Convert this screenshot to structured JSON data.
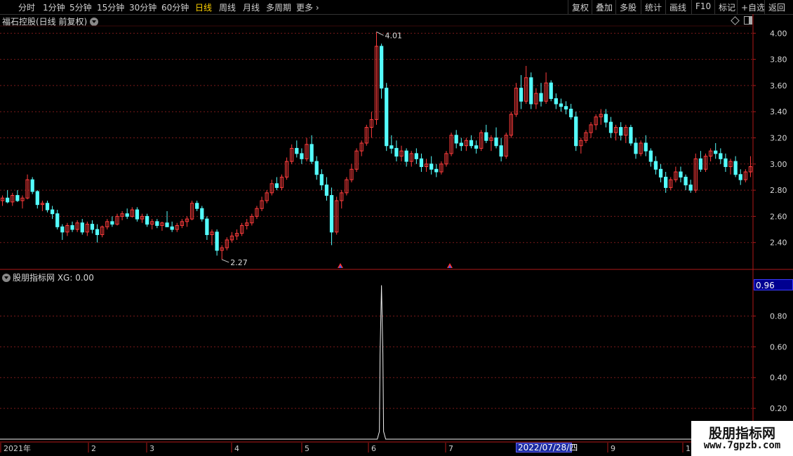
{
  "toolbar": {
    "left_items": [
      "分时",
      "1分钟",
      "5分钟",
      "15分钟",
      "30分钟",
      "60分钟",
      "日线",
      "周线",
      "月线",
      "多周期",
      "更多"
    ],
    "active": "日线",
    "right_items": [
      "复权",
      "叠加",
      "多股",
      "统计",
      "画线",
      "F10",
      "标记",
      "+自选",
      "返回"
    ]
  },
  "main_chart": {
    "header": "福石控股(日线 前复权)",
    "price_labels": [
      "4.00",
      "3.80",
      "3.60",
      "3.40",
      "3.20",
      "3.00",
      "2.80",
      "2.60",
      "2.40"
    ],
    "high_marker": "4.01",
    "low_marker": "2.27",
    "colors": {
      "up": "#ff3c3c",
      "down": "#54fcfc",
      "grid": "#7a1a1a",
      "axis": "#b01818"
    }
  },
  "indicator": {
    "header": "股朋指标网 XG: 0.00",
    "value_box": "0.96",
    "axis_labels": [
      "0.80",
      "0.60",
      "0.40",
      "0.20"
    ]
  },
  "time_axis": {
    "labels": [
      "2021年",
      "2",
      "3",
      "4",
      "5",
      "6",
      "7",
      "9",
      "1"
    ],
    "highlight": "2022/07/28/四"
  },
  "watermark": {
    "line1": "股朋指标网",
    "line2": "www.7gpzb.com"
  },
  "chart_data": {
    "type": "candlestick",
    "title": "福石控股(日线 前复权)",
    "y_range": [
      2.2,
      4.05
    ],
    "ohlc": [
      [
        2.72,
        2.76,
        2.68,
        2.74
      ],
      [
        2.74,
        2.8,
        2.7,
        2.71
      ],
      [
        2.71,
        2.78,
        2.68,
        2.76
      ],
      [
        2.76,
        2.8,
        2.71,
        2.72
      ],
      [
        2.72,
        2.76,
        2.66,
        2.74
      ],
      [
        2.74,
        2.92,
        2.73,
        2.88
      ],
      [
        2.88,
        2.9,
        2.77,
        2.79
      ],
      [
        2.79,
        2.8,
        2.66,
        2.69
      ],
      [
        2.69,
        2.72,
        2.64,
        2.7
      ],
      [
        2.7,
        2.72,
        2.63,
        2.65
      ],
      [
        2.65,
        2.68,
        2.58,
        2.62
      ],
      [
        2.62,
        2.65,
        2.5,
        2.52
      ],
      [
        2.52,
        2.54,
        2.42,
        2.48
      ],
      [
        2.48,
        2.55,
        2.45,
        2.53
      ],
      [
        2.53,
        2.56,
        2.48,
        2.5
      ],
      [
        2.5,
        2.57,
        2.48,
        2.55
      ],
      [
        2.55,
        2.58,
        2.46,
        2.48
      ],
      [
        2.48,
        2.56,
        2.45,
        2.54
      ],
      [
        2.54,
        2.57,
        2.47,
        2.5
      ],
      [
        2.5,
        2.54,
        2.4,
        2.46
      ],
      [
        2.46,
        2.53,
        2.44,
        2.52
      ],
      [
        2.52,
        2.58,
        2.5,
        2.56
      ],
      [
        2.56,
        2.6,
        2.52,
        2.54
      ],
      [
        2.54,
        2.62,
        2.53,
        2.6
      ],
      [
        2.6,
        2.64,
        2.57,
        2.62
      ],
      [
        2.62,
        2.66,
        2.58,
        2.6
      ],
      [
        2.6,
        2.67,
        2.59,
        2.65
      ],
      [
        2.65,
        2.67,
        2.56,
        2.58
      ],
      [
        2.58,
        2.62,
        2.55,
        2.6
      ],
      [
        2.6,
        2.62,
        2.52,
        2.54
      ],
      [
        2.54,
        2.58,
        2.5,
        2.56
      ],
      [
        2.56,
        2.58,
        2.51,
        2.53
      ],
      [
        2.53,
        2.56,
        2.49,
        2.55
      ],
      [
        2.55,
        2.64,
        2.53,
        2.52
      ],
      [
        2.52,
        2.56,
        2.48,
        2.5
      ],
      [
        2.5,
        2.55,
        2.48,
        2.53
      ],
      [
        2.53,
        2.58,
        2.51,
        2.56
      ],
      [
        2.56,
        2.6,
        2.52,
        2.58
      ],
      [
        2.58,
        2.72,
        2.57,
        2.7
      ],
      [
        2.7,
        2.72,
        2.64,
        2.66
      ],
      [
        2.66,
        2.68,
        2.56,
        2.58
      ],
      [
        2.58,
        2.6,
        2.42,
        2.46
      ],
      [
        2.46,
        2.5,
        2.38,
        2.48
      ],
      [
        2.48,
        2.5,
        2.3,
        2.34
      ],
      [
        2.34,
        2.38,
        2.27,
        2.36
      ],
      [
        2.36,
        2.44,
        2.34,
        2.42
      ],
      [
        2.42,
        2.48,
        2.4,
        2.45
      ],
      [
        2.45,
        2.5,
        2.42,
        2.47
      ],
      [
        2.47,
        2.55,
        2.45,
        2.53
      ],
      [
        2.53,
        2.58,
        2.5,
        2.55
      ],
      [
        2.55,
        2.62,
        2.53,
        2.6
      ],
      [
        2.6,
        2.68,
        2.58,
        2.66
      ],
      [
        2.66,
        2.75,
        2.64,
        2.72
      ],
      [
        2.72,
        2.8,
        2.7,
        2.78
      ],
      [
        2.78,
        2.88,
        2.76,
        2.85
      ],
      [
        2.85,
        2.9,
        2.8,
        2.82
      ],
      [
        2.82,
        2.92,
        2.8,
        2.9
      ],
      [
        2.9,
        3.05,
        2.88,
        3.02
      ],
      [
        3.02,
        3.15,
        3.0,
        3.12
      ],
      [
        3.12,
        3.18,
        3.05,
        3.08
      ],
      [
        3.08,
        3.12,
        3.0,
        3.04
      ],
      [
        3.04,
        3.2,
        3.02,
        3.15
      ],
      [
        3.15,
        3.22,
        3.0,
        3.02
      ],
      [
        3.02,
        3.06,
        2.88,
        2.92
      ],
      [
        2.92,
        2.96,
        2.8,
        2.84
      ],
      [
        2.84,
        2.9,
        2.72,
        2.76
      ],
      [
        2.76,
        2.82,
        2.38,
        2.48
      ],
      [
        2.48,
        2.75,
        2.46,
        2.72
      ],
      [
        2.72,
        2.8,
        2.66,
        2.78
      ],
      [
        2.78,
        2.9,
        2.76,
        2.88
      ],
      [
        2.88,
        3.0,
        2.86,
        2.96
      ],
      [
        2.96,
        3.12,
        2.94,
        3.1
      ],
      [
        3.1,
        3.18,
        3.06,
        3.16
      ],
      [
        3.16,
        3.3,
        3.14,
        3.28
      ],
      [
        3.28,
        3.4,
        3.2,
        3.34
      ],
      [
        3.34,
        4.01,
        3.3,
        3.9
      ],
      [
        3.9,
        3.92,
        3.5,
        3.58
      ],
      [
        3.58,
        3.62,
        3.1,
        3.14
      ],
      [
        3.14,
        3.22,
        3.08,
        3.12
      ],
      [
        3.12,
        3.18,
        3.02,
        3.06
      ],
      [
        3.06,
        3.14,
        3.02,
        3.1
      ],
      [
        3.1,
        3.12,
        2.98,
        3.02
      ],
      [
        3.02,
        3.1,
        2.98,
        3.08
      ],
      [
        3.08,
        3.12,
        3.0,
        3.04
      ],
      [
        3.04,
        3.08,
        2.94,
        2.98
      ],
      [
        2.98,
        3.04,
        2.94,
        3.0
      ],
      [
        3.0,
        3.06,
        2.92,
        2.96
      ],
      [
        2.96,
        3.0,
        2.9,
        2.94
      ],
      [
        2.94,
        3.02,
        2.92,
        3.0
      ],
      [
        3.0,
        3.1,
        2.98,
        3.08
      ],
      [
        3.08,
        3.24,
        3.06,
        3.22
      ],
      [
        3.22,
        3.26,
        3.12,
        3.16
      ],
      [
        3.16,
        3.2,
        3.1,
        3.14
      ],
      [
        3.14,
        3.2,
        3.1,
        3.18
      ],
      [
        3.18,
        3.22,
        3.12,
        3.14
      ],
      [
        3.14,
        3.18,
        3.08,
        3.12
      ],
      [
        3.12,
        3.26,
        3.1,
        3.24
      ],
      [
        3.24,
        3.3,
        3.16,
        3.18
      ],
      [
        3.18,
        3.22,
        3.1,
        3.2
      ],
      [
        3.2,
        3.28,
        3.12,
        3.14
      ],
      [
        3.14,
        3.2,
        3.02,
        3.06
      ],
      [
        3.06,
        3.24,
        3.04,
        3.22
      ],
      [
        3.22,
        3.4,
        3.2,
        3.38
      ],
      [
        3.38,
        3.62,
        3.36,
        3.58
      ],
      [
        3.58,
        3.68,
        3.42,
        3.48
      ],
      [
        3.48,
        3.75,
        3.46,
        3.66
      ],
      [
        3.66,
        3.7,
        3.42,
        3.46
      ],
      [
        3.46,
        3.58,
        3.42,
        3.54
      ],
      [
        3.54,
        3.62,
        3.44,
        3.48
      ],
      [
        3.48,
        3.7,
        3.46,
        3.62
      ],
      [
        3.62,
        3.64,
        3.48,
        3.5
      ],
      [
        3.5,
        3.54,
        3.42,
        3.46
      ],
      [
        3.46,
        3.5,
        3.4,
        3.44
      ],
      [
        3.44,
        3.48,
        3.38,
        3.42
      ],
      [
        3.42,
        3.46,
        3.34,
        3.36
      ],
      [
        3.36,
        3.4,
        3.1,
        3.14
      ],
      [
        3.14,
        3.2,
        3.08,
        3.18
      ],
      [
        3.18,
        3.26,
        3.16,
        3.24
      ],
      [
        3.24,
        3.32,
        3.2,
        3.3
      ],
      [
        3.3,
        3.38,
        3.26,
        3.36
      ],
      [
        3.36,
        3.42,
        3.3,
        3.38
      ],
      [
        3.38,
        3.42,
        3.28,
        3.32
      ],
      [
        3.32,
        3.36,
        3.2,
        3.24
      ],
      [
        3.24,
        3.3,
        3.18,
        3.28
      ],
      [
        3.28,
        3.32,
        3.18,
        3.22
      ],
      [
        3.22,
        3.3,
        3.16,
        3.28
      ],
      [
        3.28,
        3.3,
        3.14,
        3.16
      ],
      [
        3.16,
        3.2,
        3.04,
        3.08
      ],
      [
        3.08,
        3.18,
        3.06,
        3.16
      ],
      [
        3.16,
        3.22,
        3.06,
        3.1
      ],
      [
        3.1,
        3.12,
        2.98,
        3.02
      ],
      [
        3.02,
        3.06,
        2.92,
        2.96
      ],
      [
        2.96,
        3.0,
        2.86,
        2.9
      ],
      [
        2.9,
        2.94,
        2.78,
        2.82
      ],
      [
        2.82,
        2.9,
        2.8,
        2.88
      ],
      [
        2.88,
        2.98,
        2.86,
        2.94
      ],
      [
        2.94,
        2.98,
        2.86,
        2.9
      ],
      [
        2.9,
        2.92,
        2.8,
        2.84
      ],
      [
        2.84,
        2.88,
        2.78,
        2.8
      ],
      [
        2.8,
        3.08,
        2.78,
        3.04
      ],
      [
        3.04,
        3.1,
        2.94,
        2.96
      ],
      [
        2.96,
        3.08,
        2.94,
        3.06
      ],
      [
        3.06,
        3.12,
        3.02,
        3.1
      ],
      [
        3.1,
        3.16,
        3.04,
        3.08
      ],
      [
        3.08,
        3.12,
        3.0,
        3.04
      ],
      [
        3.04,
        3.08,
        2.94,
        2.98
      ],
      [
        2.98,
        3.04,
        2.92,
        3.02
      ],
      [
        3.02,
        3.06,
        2.9,
        2.92
      ],
      [
        2.92,
        2.96,
        2.84,
        2.88
      ],
      [
        2.88,
        2.96,
        2.86,
        2.94
      ],
      [
        2.94,
        3.06,
        2.9,
        2.98
      ]
    ],
    "indicator_series": {
      "name": "XG",
      "spike_index": 76,
      "spike_value": 1.0,
      "current": 0.0
    }
  }
}
